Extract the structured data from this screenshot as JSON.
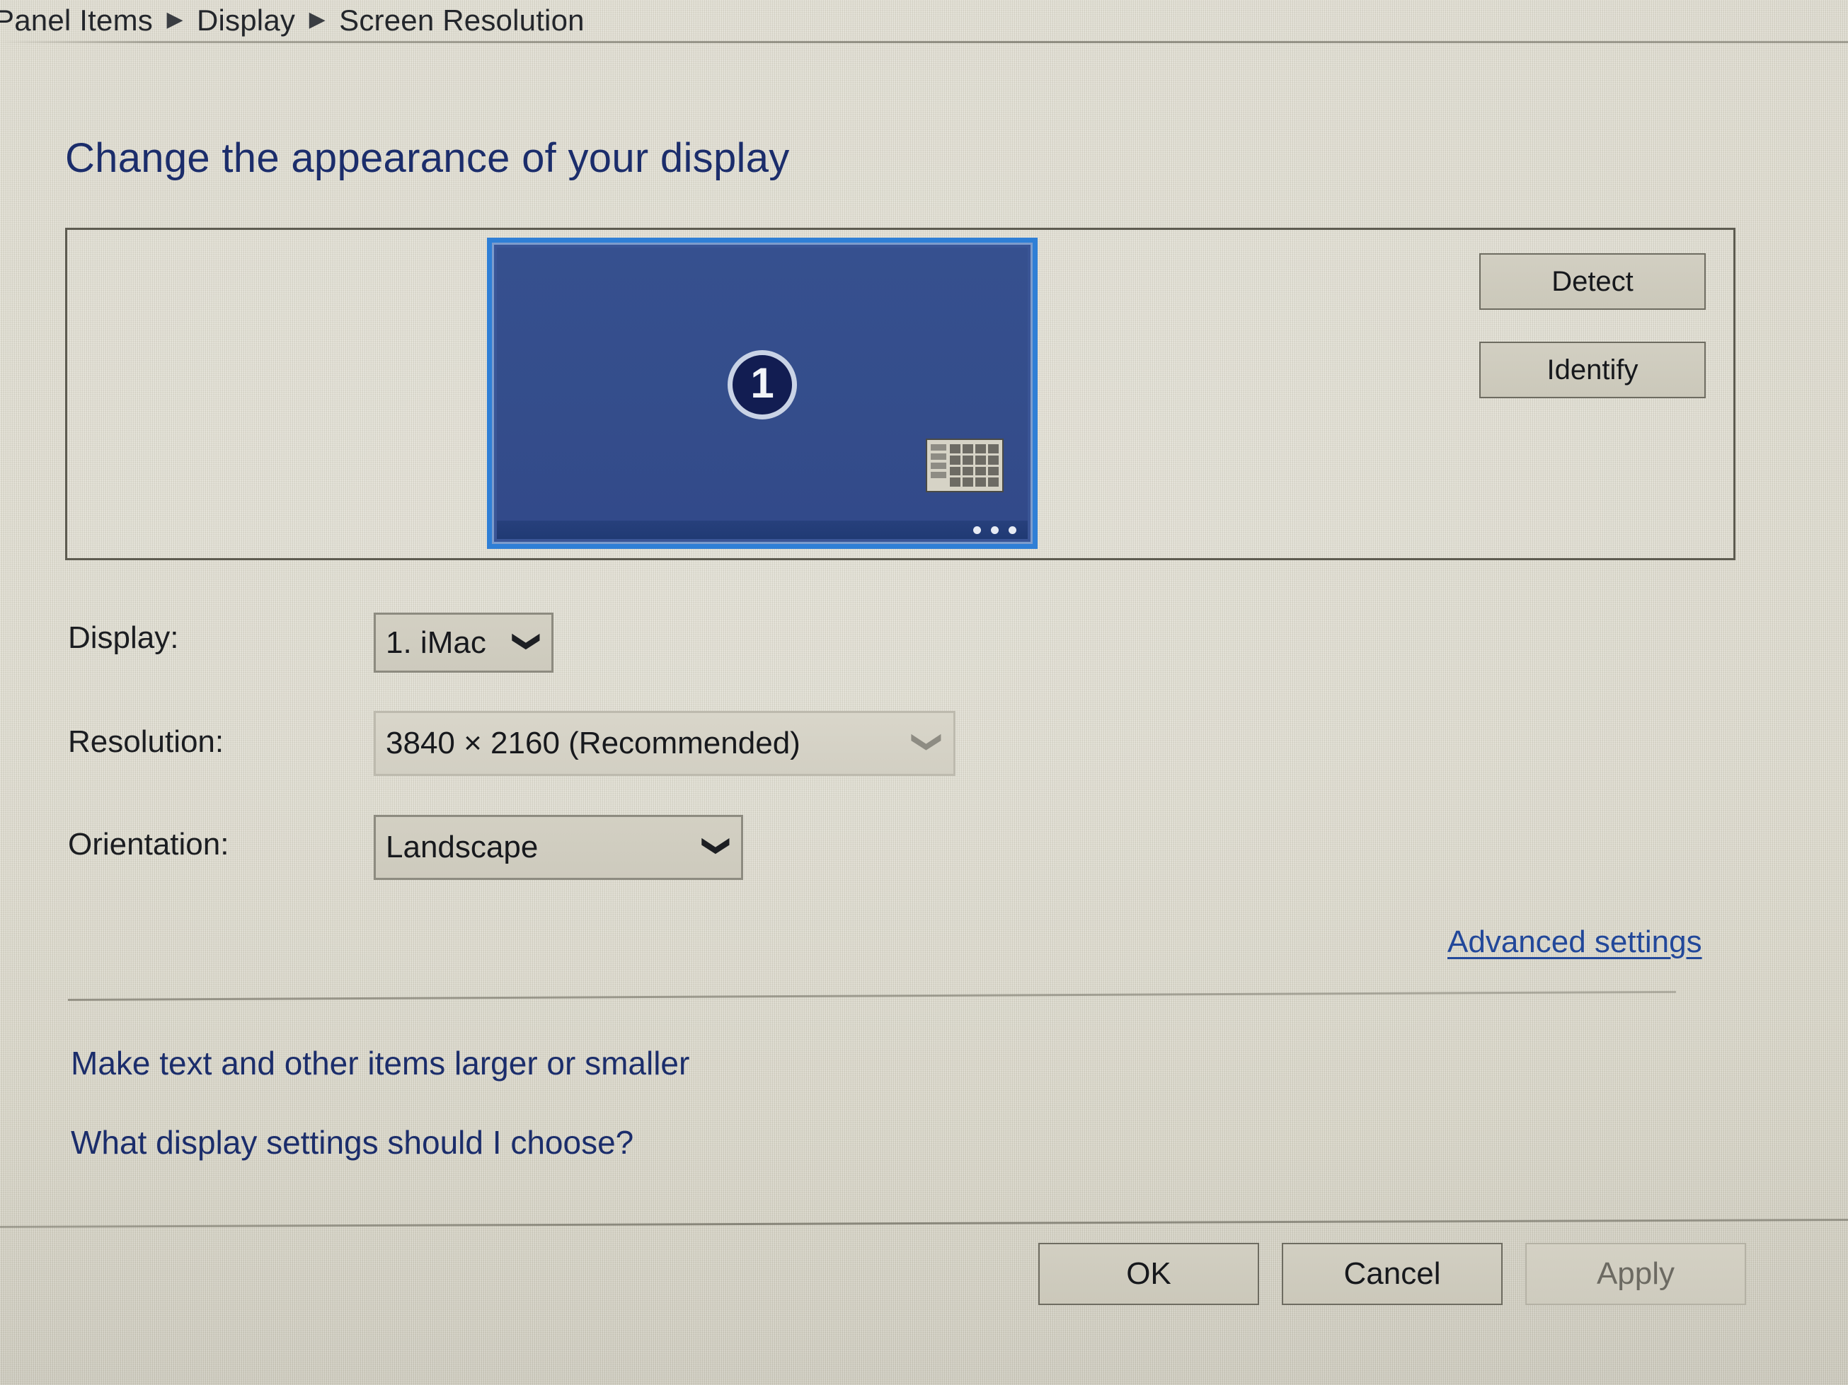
{
  "breadcrumb": {
    "items": [
      "Panel Items",
      "Display",
      "Screen Resolution"
    ],
    "separator": "▶"
  },
  "page": {
    "title": "Change the appearance of your display"
  },
  "monitor_panel": {
    "preview": {
      "number_label": "1",
      "selected": true,
      "screen_color": "#36508f",
      "selection_border_color": "#2f7fd6",
      "badge_color": "#121d52",
      "taskbar_dots": 3
    },
    "buttons": [
      {
        "label": "Detect",
        "name": "detect-button",
        "disabled": false
      },
      {
        "label": "Identify",
        "name": "identify-button",
        "disabled": false
      }
    ]
  },
  "form": {
    "display": {
      "label": "Display:",
      "value": "1. iMac",
      "chevron": "⌄"
    },
    "resolution": {
      "label": "Resolution:",
      "value": "3840 × 2160 (Recommended)",
      "chevron": "⌄"
    },
    "orientation": {
      "label": "Orientation:",
      "value": "Landscape",
      "chevron": "⌄"
    }
  },
  "links": {
    "advanced_settings": "Advanced settings",
    "make_text_larger": "Make text and other items larger or smaller",
    "what_display_settings": "What display settings should I choose?"
  },
  "footer": {
    "buttons": [
      {
        "label": "OK",
        "name": "ok-button",
        "disabled": false
      },
      {
        "label": "Cancel",
        "name": "cancel-button",
        "disabled": false
      },
      {
        "label": "Apply",
        "name": "apply-button",
        "disabled": true
      }
    ]
  },
  "colors": {
    "background": "#dcd9cb",
    "title_blue": "#1b2d6b",
    "link_blue": "#22489a",
    "monitor_blue": "#36508f",
    "selection_blue": "#2f7fd6",
    "text": "#17191d"
  }
}
